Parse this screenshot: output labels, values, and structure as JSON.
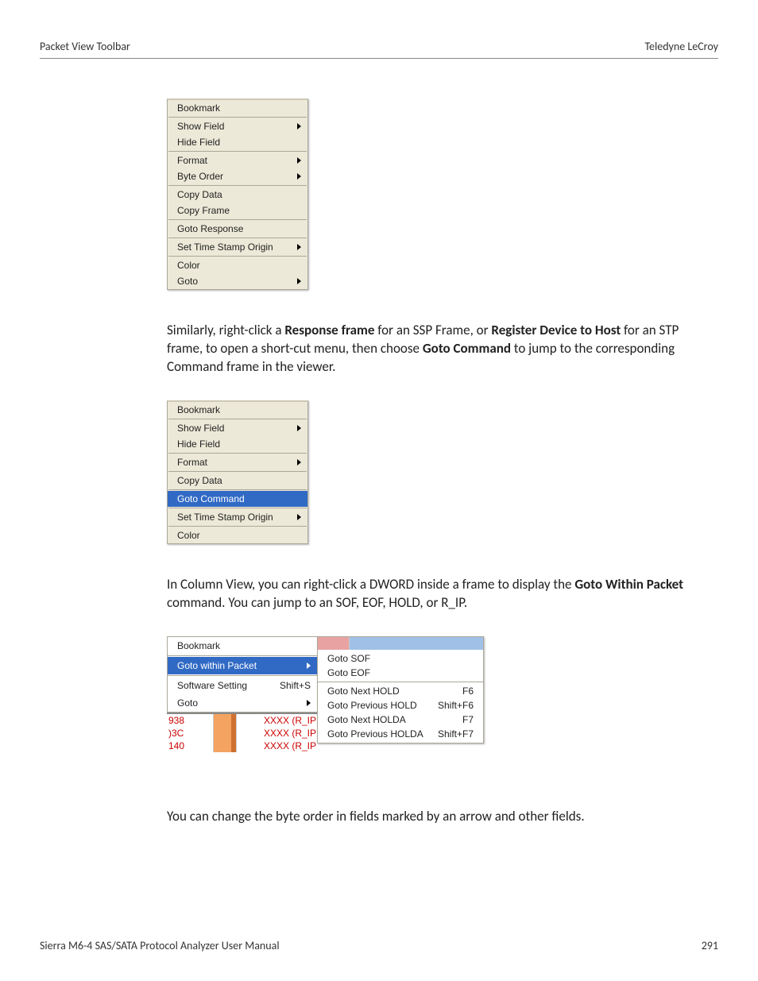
{
  "header": {
    "left": "Packet View Toolbar",
    "right": "Teledyne LeCroy"
  },
  "menu1": {
    "bookmark": "Bookmark",
    "show_field": "Show Field",
    "hide_field": "Hide Field",
    "format": "Format",
    "byte_order": "Byte Order",
    "copy_data": "Copy Data",
    "copy_frame": "Copy Frame",
    "goto_response": "Goto Response",
    "set_time_stamp": "Set Time Stamp Origin",
    "color": "Color",
    "goto": "Goto"
  },
  "para1": {
    "a": "Similarly, right-click a ",
    "b": "Response frame",
    "c": " for an SSP Frame, or ",
    "d": "Register Device to Host",
    "e": " for an STP frame, to open a short-cut menu, then choose ",
    "f": "Goto Command",
    "g": " to jump to the corresponding Command frame in the viewer."
  },
  "menu2": {
    "bookmark": "Bookmark",
    "show_field": "Show Field",
    "hide_field": "Hide Field",
    "format": "Format",
    "copy_data": "Copy Data",
    "goto_command": "Goto Command",
    "set_time_stamp": "Set Time Stamp Origin",
    "color": "Color"
  },
  "para2": {
    "a": "In Column View, you can right-click a DWORD inside a frame to display the ",
    "b": "Goto Within Packet",
    "c": " command. You can jump to an SOF, EOF, HOLD, or R_IP."
  },
  "menu3": {
    "bookmark": "Bookmark",
    "goto_within": "Goto within Packet",
    "software_setting": "Software Setting",
    "software_shortcut": "Shift+S",
    "goto": "Goto"
  },
  "datarows": [
    {
      "a": "938",
      "c": "XXXX (R_IP"
    },
    {
      "a": ")3C",
      "c": "XXXX (R_IP"
    },
    {
      "a": "140",
      "c": "XXXX (R_IP"
    }
  ],
  "submenu": {
    "goto_sof": "Goto SOF",
    "goto_eof": "Goto EOF",
    "next_hold": {
      "l": "Goto Next HOLD",
      "s": "F6"
    },
    "prev_hold": {
      "l": "Goto Previous HOLD",
      "s": "Shift+F6"
    },
    "next_holda": {
      "l": "Goto Next HOLDA",
      "s": "F7"
    },
    "prev_holda": {
      "l": "Goto Previous HOLDA",
      "s": "Shift+F7"
    }
  },
  "para3": "You can change the byte order in fields marked by an arrow and other fields.",
  "footer": {
    "left": "Sierra M6-4 SAS/SATA Protocol Analyzer User Manual",
    "right": "291"
  }
}
